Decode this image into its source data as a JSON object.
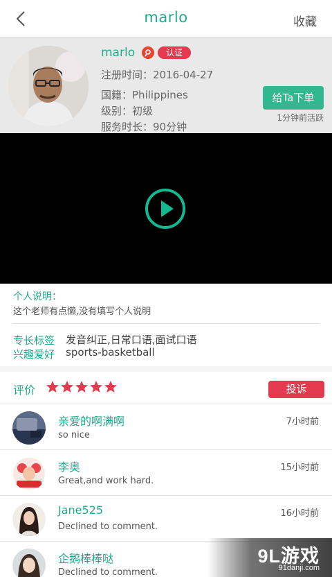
{
  "nav": {
    "title": "marlo",
    "favorite_label": "收藏"
  },
  "profile": {
    "name": "marlo",
    "verified_label": "认证",
    "register_label": "注册时间：",
    "register_value": "2016-04-27",
    "nationality_label": "国籍：",
    "nationality_value": "Philippines",
    "level_label": "级别：",
    "level_value": "初级",
    "duration_label": "服务时长：",
    "duration_value": "90分钟",
    "order_button": "给Ta下单",
    "active_status": "1分钟前活跃"
  },
  "about": {
    "title": "个人说明：",
    "text": "这个老师有点懒,没有填写个人说明",
    "skills_label": "专长标签",
    "skills_value": "发音纠正,日常口语,面试口语",
    "hobby_label": "兴趣爱好",
    "hobby_value": "sports-basketball"
  },
  "reviews": {
    "label": "评价",
    "rating": 5,
    "complain_button": "投诉",
    "items": [
      {
        "name": "亲爱的啊满啊",
        "text": "so nice",
        "time": "7小时前"
      },
      {
        "name": "李奥",
        "text": "Great,and work hard.",
        "time": "15小时前"
      },
      {
        "name": "Jane525",
        "text": "Declined to comment.",
        "time": "16小时前"
      },
      {
        "name": "企鹅棒棒哒",
        "text": "Declined to comment.",
        "time": ""
      }
    ]
  },
  "watermark": {
    "main": "9L游戏",
    "sub": "91danji.com"
  },
  "colors": {
    "accent": "#22a98c",
    "button_green": "#33b78e",
    "red": "#e33a4f",
    "play_ring": "#12b990"
  },
  "icons": [
    "back-arrow-icon",
    "verify-icon",
    "play-icon",
    "star-icon"
  ]
}
